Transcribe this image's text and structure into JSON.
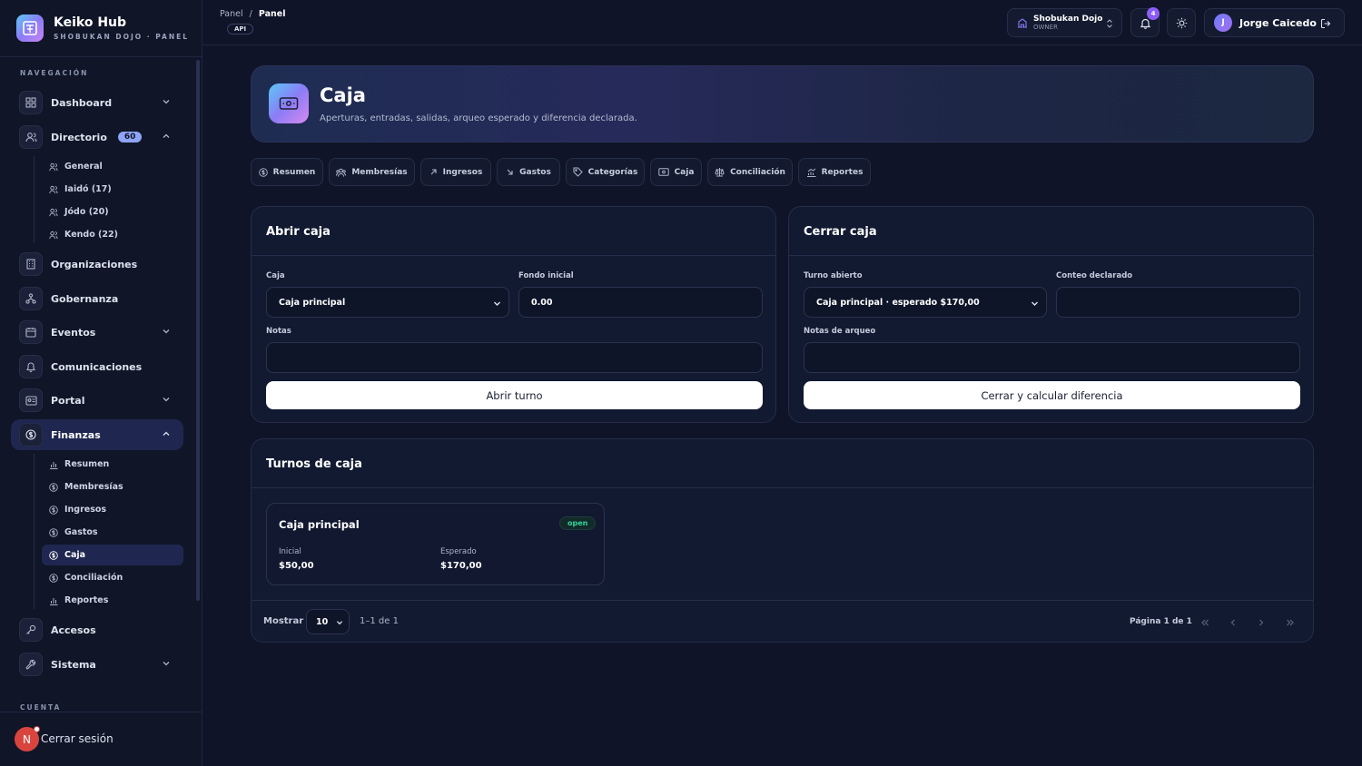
{
  "app": {
    "title": "Keiko Hub",
    "subtitle": "SHOBUKAN DOJO · PANEL"
  },
  "sidebar": {
    "section_nav": "NAVEGACIÓN",
    "section_account": "CUENTA",
    "items": [
      {
        "label": "Dashboard",
        "icon": "grid-icon"
      },
      {
        "label": "Directorio",
        "icon": "users-icon",
        "badge": "60"
      },
      {
        "label": "Organizaciones",
        "icon": "building-icon"
      },
      {
        "label": "Gobernanza",
        "icon": "hierarchy-icon"
      },
      {
        "label": "Eventos",
        "icon": "calendar-icon"
      },
      {
        "label": "Comunicaciones",
        "icon": "bell-icon"
      },
      {
        "label": "Portal",
        "icon": "id-card-icon"
      },
      {
        "label": "Finanzas",
        "icon": "dollar-icon"
      },
      {
        "label": "Accesos",
        "icon": "key-icon"
      },
      {
        "label": "Sistema",
        "icon": "wrench-icon"
      }
    ],
    "directorio_sub": [
      "General",
      "Iaidó (17)",
      "Jódo (20)",
      "Kendo (22)"
    ],
    "finanzas_sub": [
      "Resumen",
      "Membresías",
      "Ingresos",
      "Gastos",
      "Caja",
      "Conciliación",
      "Reportes"
    ],
    "logout_label": "Cerrar sesión",
    "avatar_initial": "N"
  },
  "topbar": {
    "crumb_root": "Panel",
    "crumb_sep": "/",
    "crumb_current": "Panel",
    "api_badge": "API",
    "org_name": "Shobukan Dojo",
    "org_role": "OWNER",
    "notif_count": "4",
    "user_initial": "J",
    "user_name": "Jorge Caicedo"
  },
  "hero": {
    "title": "Caja",
    "subtitle": "Aperturas, entradas, salidas, arqueo esperado y diferencia declarada."
  },
  "tabs": [
    "Resumen",
    "Membresías",
    "Ingresos",
    "Gastos",
    "Categorías",
    "Caja",
    "Conciliación",
    "Reportes"
  ],
  "open_box": {
    "title": "Abrir caja",
    "caja_label": "Caja",
    "caja_value": "Caja principal",
    "fondo_label": "Fondo inicial",
    "fondo_value": "0.00",
    "notas_label": "Notas",
    "notas_value": "",
    "button": "Abrir turno"
  },
  "close_box": {
    "title": "Cerrar caja",
    "turno_label": "Turno abierto",
    "turno_value": "Caja principal · esperado $170,00",
    "conteo_label": "Conteo declarado",
    "conteo_value": "",
    "notas_label": "Notas de arqueo",
    "notas_value": "",
    "button": "Cerrar y calcular diferencia"
  },
  "shifts": {
    "title": "Turnos de caja",
    "items": [
      {
        "name": "Caja principal",
        "status": "open",
        "initial_label": "Inicial",
        "initial_value": "$50,00",
        "expected_label": "Esperado",
        "expected_value": "$170,00"
      }
    ],
    "show_label": "Mostrar",
    "page_size": "10",
    "range": "1–1 de 1",
    "page_info": "Página 1 de 1"
  },
  "colors": {
    "accent": "#8b7cf6",
    "background": "#0f1428",
    "success": "#34d399",
    "danger": "#d9453e"
  }
}
